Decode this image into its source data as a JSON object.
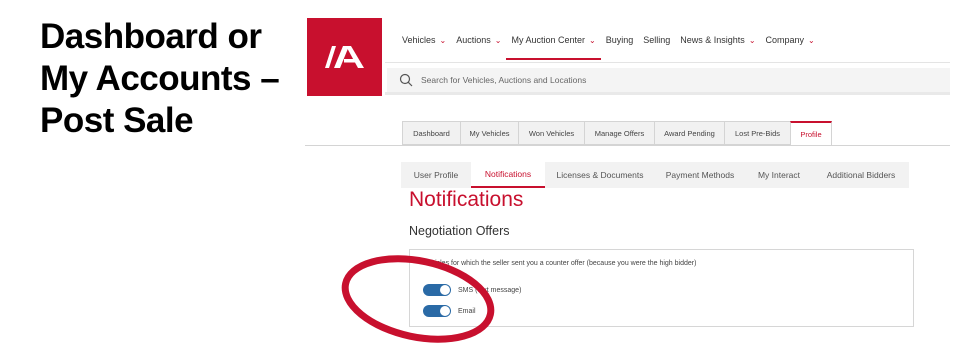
{
  "slide": {
    "title_lines": [
      "Dashboard or",
      "My Accounts –",
      "Post Sale"
    ]
  },
  "brand": {
    "logo_text": "IAA",
    "primary_color": "#c8102e",
    "toggle_color": "#2a6aa6"
  },
  "top_nav": {
    "items": [
      {
        "label": "Vehicles",
        "has_dropdown": true
      },
      {
        "label": "Auctions",
        "has_dropdown": true
      },
      {
        "label": "My Auction Center",
        "has_dropdown": true,
        "active": true
      },
      {
        "label": "Buying",
        "has_dropdown": false
      },
      {
        "label": "Selling",
        "has_dropdown": false
      },
      {
        "label": "News & Insights",
        "has_dropdown": true
      },
      {
        "label": "Company",
        "has_dropdown": true
      }
    ],
    "caret": "⌄"
  },
  "search": {
    "placeholder": "Search for Vehicles, Auctions and Locations",
    "icon": "search-icon"
  },
  "tabs": [
    {
      "label": "Dashboard"
    },
    {
      "label": "My Vehicles"
    },
    {
      "label": "Won Vehicles"
    },
    {
      "label": "Manage Offers"
    },
    {
      "label": "Award Pending"
    },
    {
      "label": "Lost Pre-Bids"
    },
    {
      "label": "Profile",
      "active": true
    }
  ],
  "subtabs": [
    {
      "label": "User Profile"
    },
    {
      "label": "Notifications",
      "active": true
    },
    {
      "label": "Licenses & Documents"
    },
    {
      "label": "Payment Methods"
    },
    {
      "label": "My Interact"
    },
    {
      "label": "Additional Bidders"
    }
  ],
  "page": {
    "title": "Notifications",
    "section_title": "Negotiation Offers",
    "description": "Vehicles for which the seller sent you a counter offer (because you were the high bidder)",
    "toggles": [
      {
        "label": "SMS (text message)",
        "on": true
      },
      {
        "label": "Email",
        "on": true
      }
    ]
  },
  "annotation": {
    "shape": "ellipse",
    "color": "#c8102e"
  }
}
